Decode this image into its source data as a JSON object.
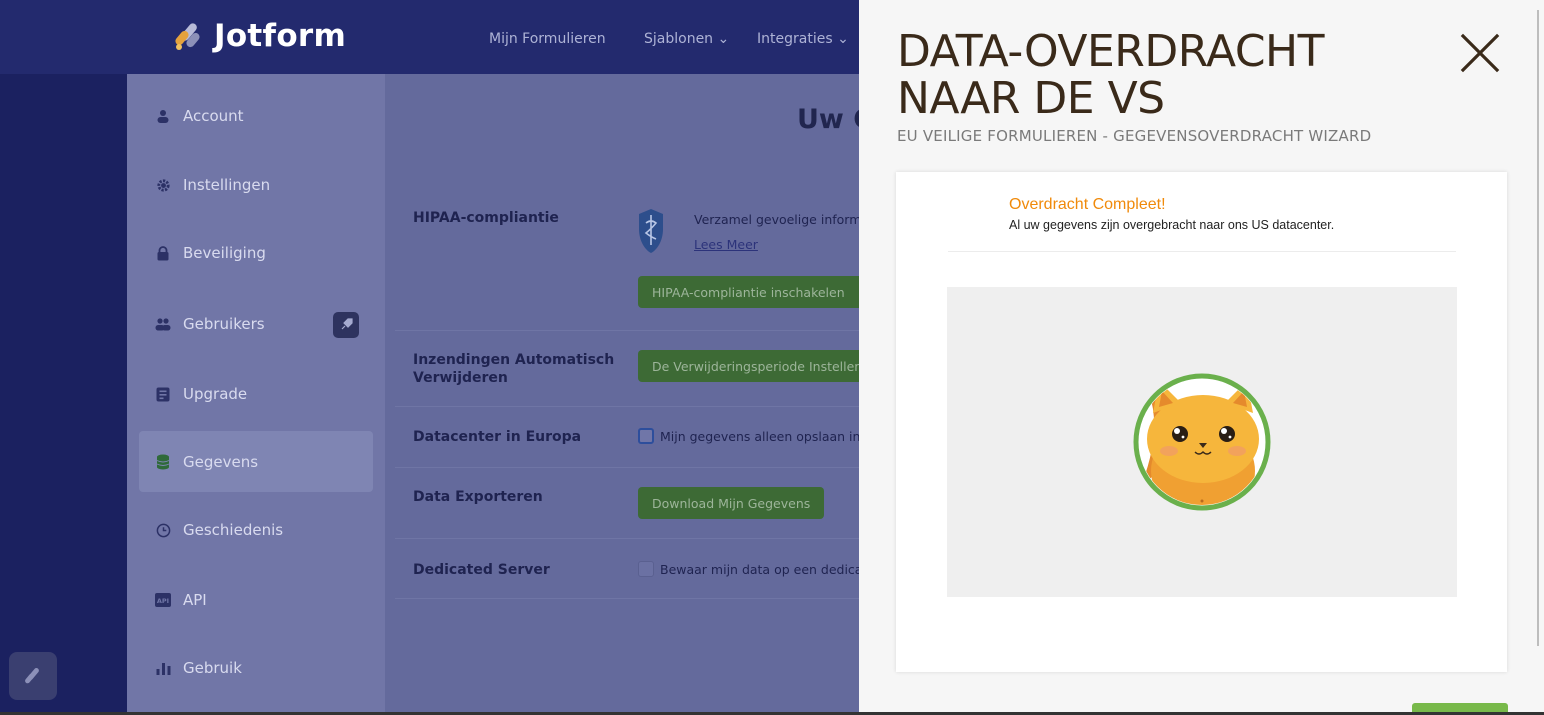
{
  "app": {
    "brand": "Jotform",
    "nav": [
      {
        "label": "Mijn Formulieren"
      },
      {
        "label": "Sjablonen ⌄"
      },
      {
        "label": "Integraties ⌄"
      }
    ],
    "heading": "Uw G"
  },
  "sidebar": {
    "items": [
      {
        "label": "Account",
        "icon": "user-icon"
      },
      {
        "label": "Instellingen",
        "icon": "gear-icon"
      },
      {
        "label": "Beveiliging",
        "icon": "lock-icon"
      },
      {
        "label": "Gebruikers",
        "icon": "users-icon"
      },
      {
        "label": "Upgrade",
        "icon": "upgrade-icon"
      },
      {
        "label": "Gegevens",
        "icon": "database-icon"
      },
      {
        "label": "Geschiedenis",
        "icon": "clock-icon"
      },
      {
        "label": "API",
        "icon": "api-icon"
      },
      {
        "label": "Gebruik",
        "icon": "bar-chart-icon"
      }
    ],
    "active": "Gegevens"
  },
  "settings": {
    "hipaa": {
      "label": "HIPAA-compliantie",
      "text": "Verzamel gevoelige inform",
      "link": "Lees Meer",
      "button": "HIPAA-compliantie inschakelen"
    },
    "auto_delete": {
      "label": "Inzendingen Automatisch Verwijderen",
      "button": "De Verwijderingsperiode Instellen"
    },
    "eu_datacenter": {
      "label": "Datacenter in Europa",
      "checkbox_label": "Mijn gegevens alleen opslaan in"
    },
    "export": {
      "label": "Data Exporteren",
      "button": "Download Mijn Gegevens"
    },
    "dedicated": {
      "label": "Dedicated Server",
      "checkbox_label": "Bewaar mijn data op een dedica"
    }
  },
  "modal": {
    "title": "DATA-OVERDRACHT NAAR DE VS",
    "subtitle": "EU VEILIGE FORMULIEREN - GEGEVENSOVERDRACHT WIZARD",
    "close_icon": "close-icon",
    "success_title": "Overdracht Compleet!",
    "success_text": "Al uw gegevens zijn overgebracht naar ons US datacenter."
  },
  "colors": {
    "accent_orange": "#f08a0b",
    "accent_green": "#78b94a",
    "app_navy": "#232a6e"
  }
}
